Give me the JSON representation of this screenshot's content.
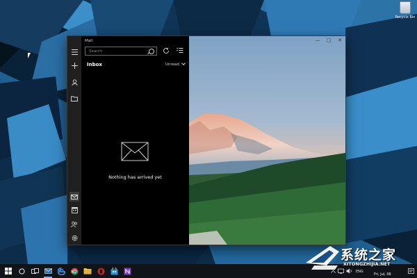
{
  "desktop": {
    "recycle_bin_label": "Recycle Bin"
  },
  "mail": {
    "app_title": "Mail",
    "search_placeholder": "Search",
    "folder_title": "Inbox",
    "filter_label": "Unread",
    "empty_message": "Nothing has arrived yet",
    "rail_icons": [
      "hamburger-menu-icon",
      "new-mail-icon",
      "accounts-icon",
      "folders-icon",
      "mail-icon",
      "calendar-icon",
      "people-icon",
      "settings-icon"
    ]
  },
  "window_controls": [
    "minimize-icon",
    "maximize-icon",
    "close-icon"
  ],
  "taskbar": {
    "icons": [
      "windows-start-icon",
      "cortana-icon",
      "task-view-icon",
      "mail-icon",
      "edge-icon",
      "chrome-icon",
      "file-explorer-icon",
      "opera-icon",
      "store-icon",
      "onenote-icon"
    ],
    "input_language": "ENG",
    "date_text": "Fri, Jul, 06"
  },
  "watermark": {
    "title": "系统之家",
    "url": "XITONGZHIJIA.NET"
  },
  "colors": {
    "window_bg": "#000000",
    "rail_bg": "#202020",
    "taskbar_bg": "#101418",
    "accent": "#7fb4e8"
  }
}
